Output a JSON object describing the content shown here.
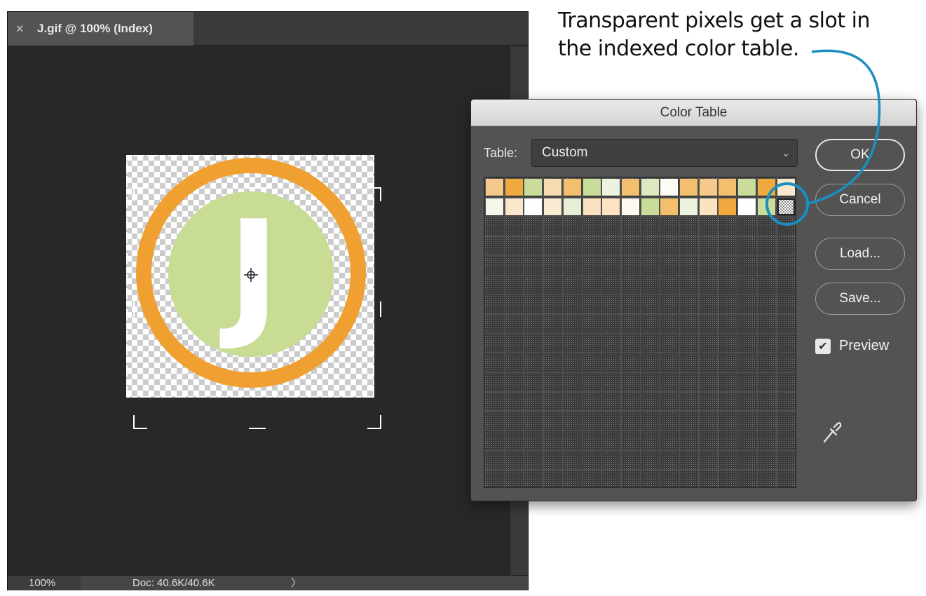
{
  "document": {
    "tab_title": "J.gif @ 100% (Index)",
    "tab_close_glyph": "×",
    "zoom": "100%",
    "doc_size": "Doc: 40.6K/40.6K",
    "status_arrow": "〉",
    "image_letter": "J"
  },
  "callout": {
    "line1": "Transparent pixels get a slot in",
    "line2": "the indexed color table."
  },
  "dialog": {
    "title": "Color Table",
    "table_label": "Table:",
    "table_value": "Custom",
    "buttons": {
      "ok": "OK",
      "cancel": "Cancel",
      "load": "Load...",
      "save": "Save..."
    },
    "preview_label": "Preview",
    "preview_checked": true,
    "swatches_row1": [
      "#f5c98b",
      "#f0a93f",
      "#c9dc9a",
      "#f5dbb0",
      "#f3bf6e",
      "#c9dc9a",
      "#eef3e0",
      "#f3bf6e",
      "#dbe8c0",
      "#fdfbf6",
      "#f3bf6e",
      "#f5c98b",
      "#f3bf6e",
      "#c9dc9a",
      "#f0a93f",
      "#f8e8cc"
    ],
    "swatches_row2": [
      "#f3f7ea",
      "#fbe7cc",
      "#fefefe",
      "#f9ead2",
      "#e6efd6",
      "#fbe2c0",
      "#fde3c2",
      "#fdfaf2",
      "#c9dc9a",
      "#f3bf6e",
      "#eef3e0",
      "#fbe2c0",
      "#f0a93f",
      "#fefefe",
      "#c9dc9a",
      "transparent"
    ]
  },
  "colors": {
    "accent_callout": "#1a8fc0",
    "ring_orange": "#f0a030",
    "disc_green": "#c8dc94"
  },
  "icons": {
    "close": "close-icon",
    "chevron": "chevron-down-icon",
    "checkmark": "checkmark-icon",
    "eyedropper": "eyedropper-icon",
    "crosshair": "crosshair-icon"
  }
}
